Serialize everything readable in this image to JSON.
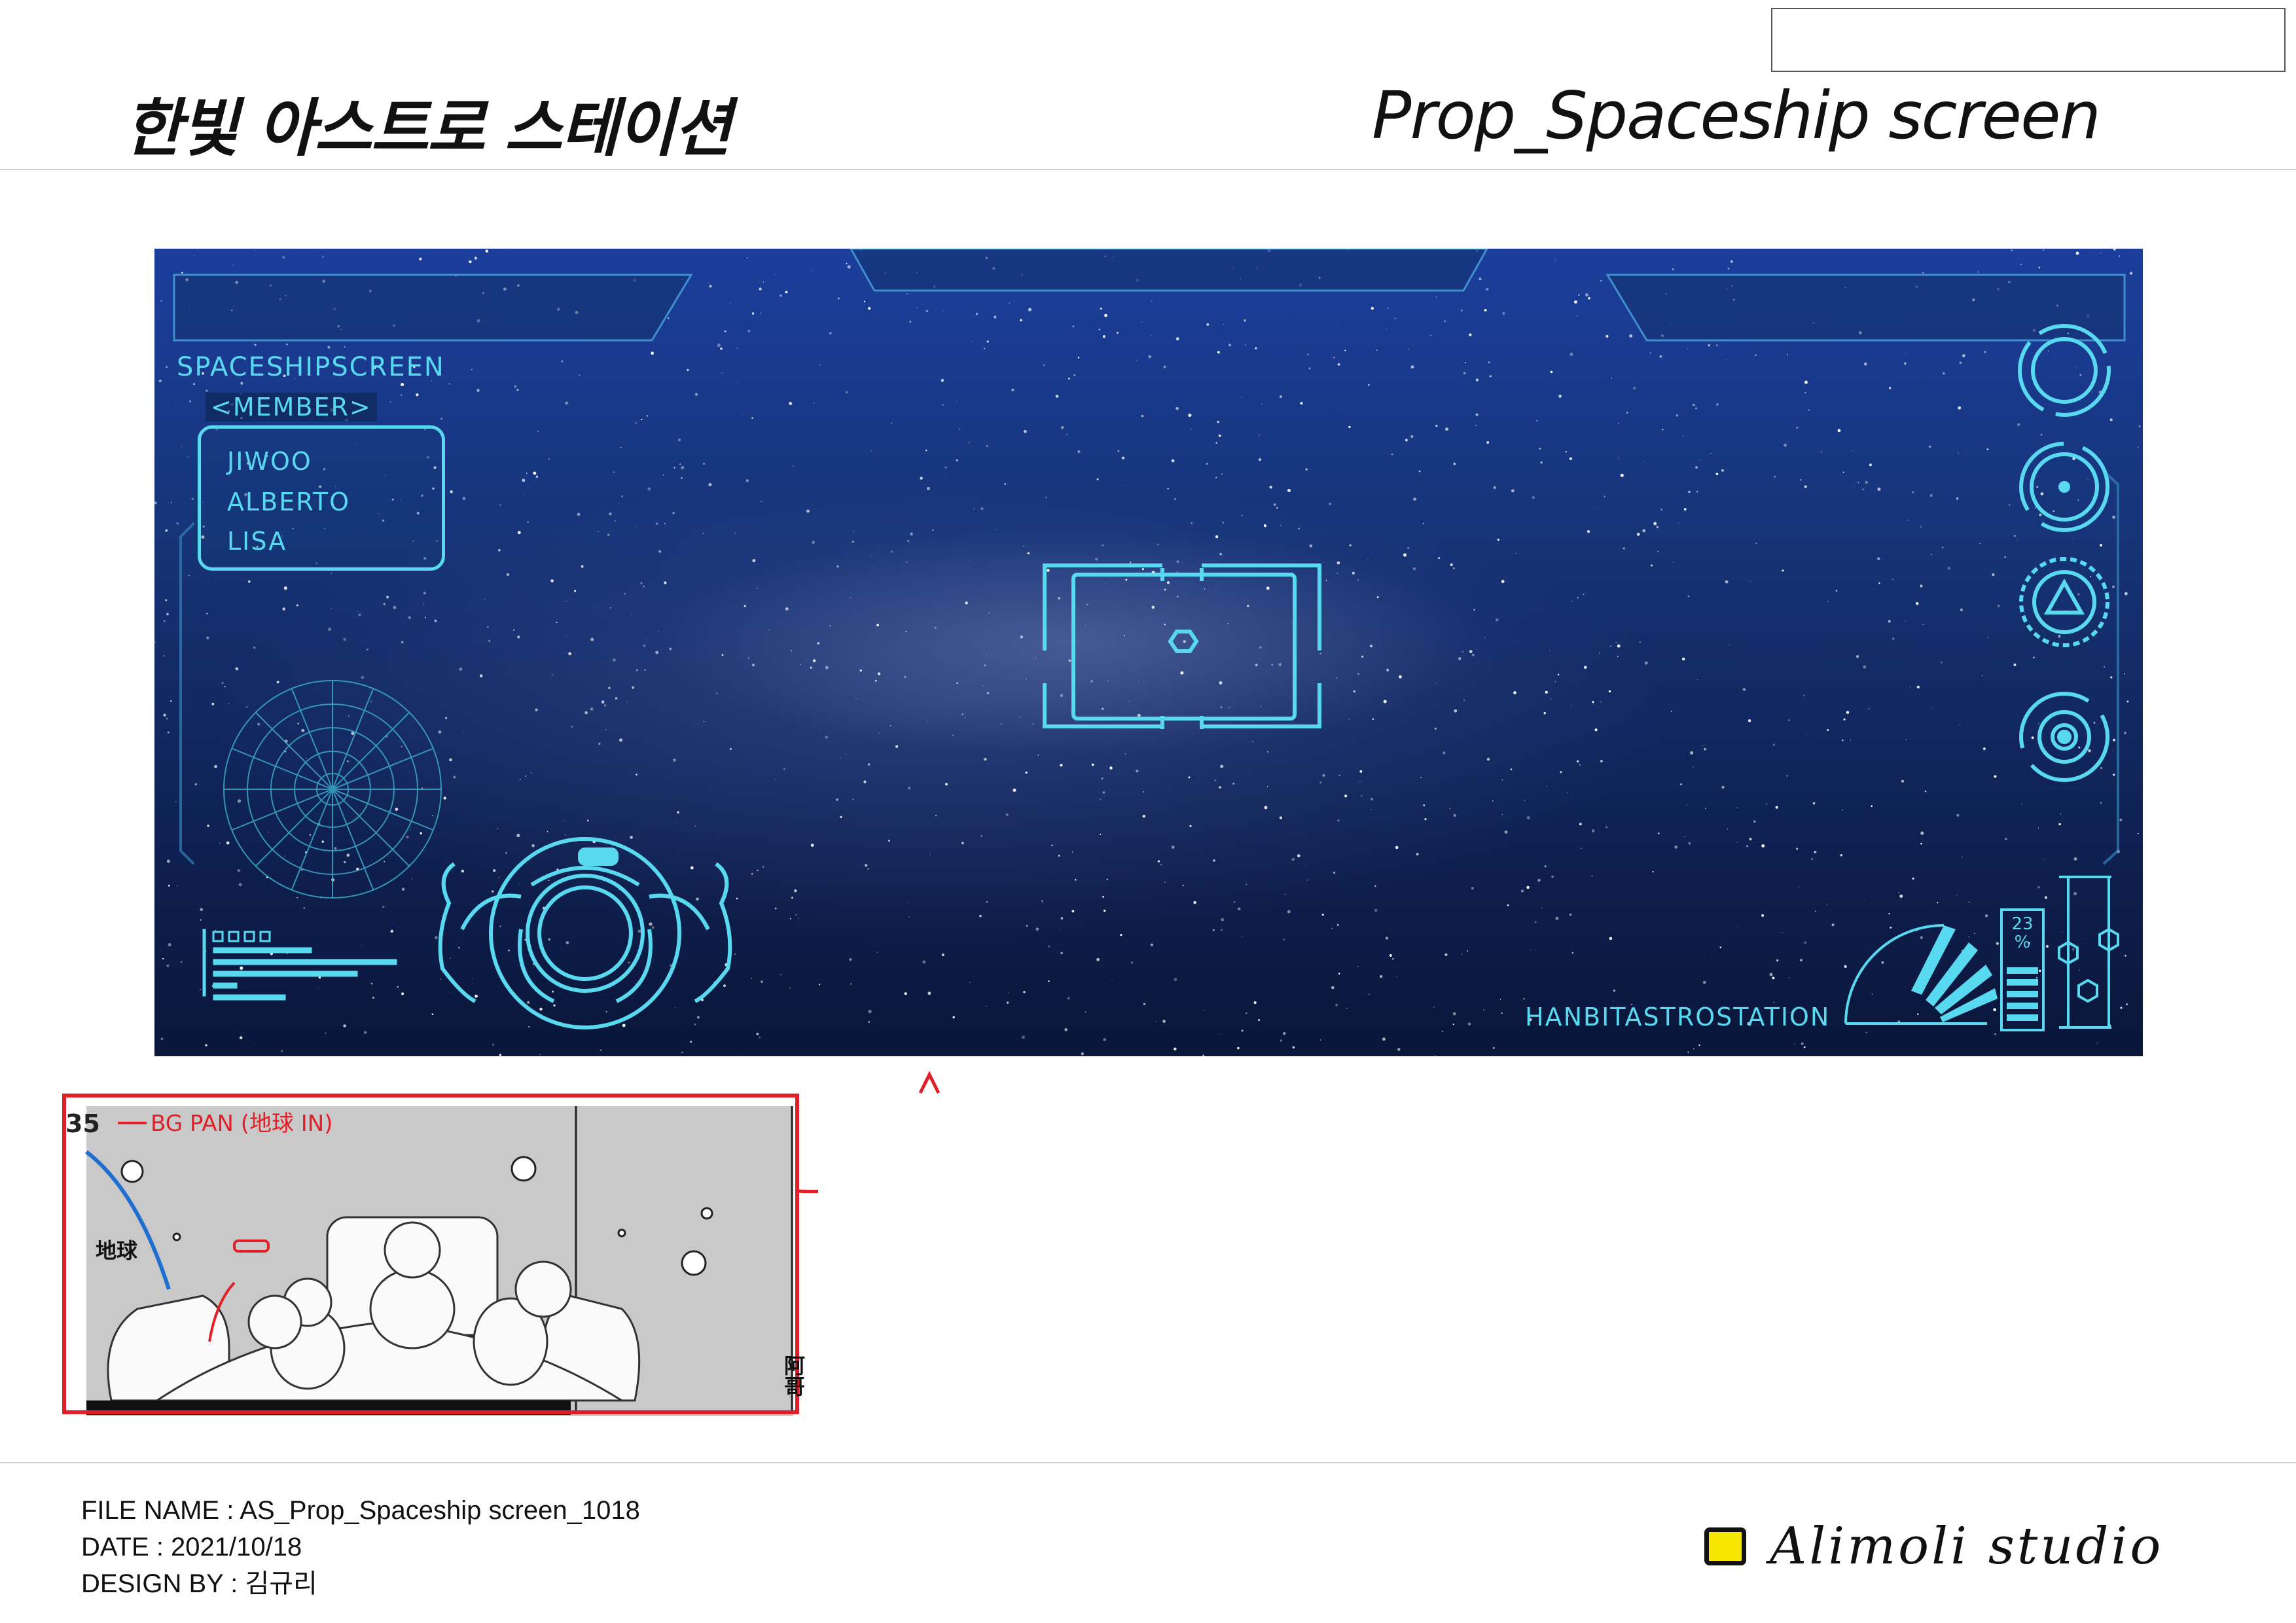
{
  "header": {
    "title_ko": "한빛 아스트로 스테이션",
    "title_en": "Prop_Spaceship screen"
  },
  "screen": {
    "title": "SPACESHIPSCREEN",
    "member_tag": "<MEMBER>",
    "members": [
      "JIWOO",
      "ALBERTO",
      "LISA"
    ],
    "station_label": "HANBITASTROSTATION",
    "gauge_value": "23",
    "gauge_unit": "%",
    "hud_color": "#59d9f0"
  },
  "storyboard": {
    "cut_number": "35",
    "note": "BG PAN (地球 IN)",
    "earth_label": "地球",
    "side_note": "阿哥"
  },
  "footer": {
    "file_name": "FILE NAME : AS_Prop_Spaceship screen_1018",
    "date": "DATE : 2021/10/18",
    "design_by": "DESIGN BY : 김규리"
  },
  "logo": {
    "text": "Alimoli studio",
    "color": "#f7e600"
  }
}
